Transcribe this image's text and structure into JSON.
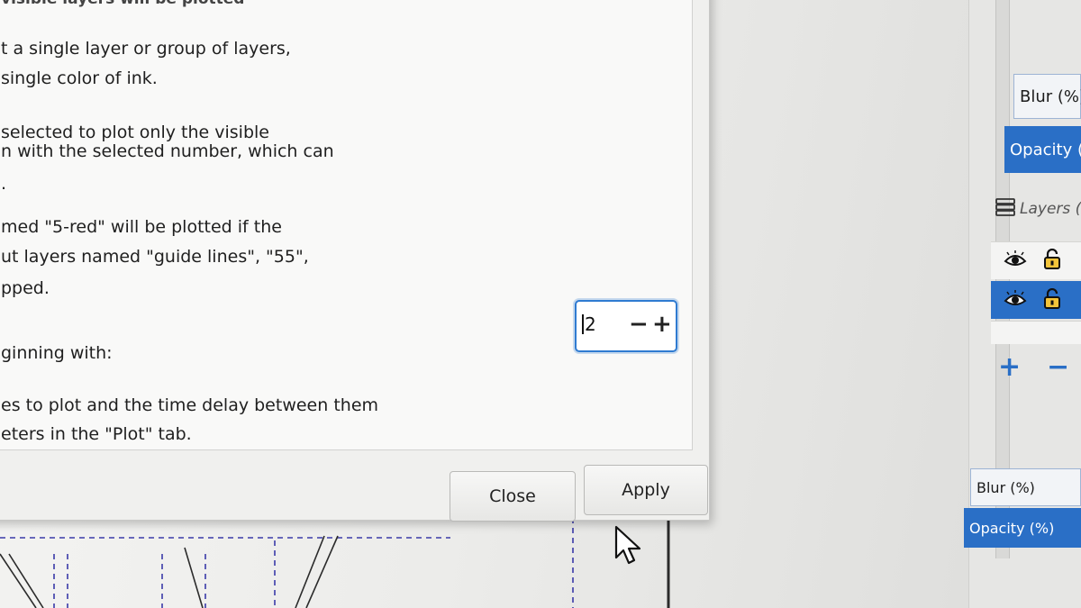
{
  "dialog": {
    "help_text": {
      "line_top": "visible layers will be plotted",
      "line_1": "t a single layer or group of layers,",
      "line_2": "single color of ink.",
      "line_3": "selected to plot only the visible",
      "line_4": "n with the selected number, which can",
      "line_5": ".",
      "line_6": "med \"5-red\" will be plotted if the",
      "line_7": "ut layers named \"guide lines\", \"55\",",
      "line_8": "pped.",
      "line_9": "ginning with:",
      "line_10": "es to plot and the time delay between them",
      "line_11": "eters in the \"Plot\" tab."
    },
    "layer_number": {
      "value": "2",
      "decrement_label": "−",
      "increment_label": "+"
    },
    "buttons": {
      "close_label": "Close",
      "apply_label": "Apply"
    }
  },
  "right_panel": {
    "blur_label_top": "Blur (%)",
    "opacity_label_top": "Opacity (",
    "layers_tab_label": "Layers (S",
    "layer_rows": [
      {
        "visibility_icon": "eye-icon",
        "lock_icon": "lock-open-icon",
        "selected": false
      },
      {
        "visibility_icon": "eye-icon",
        "lock_icon": "lock-open-icon",
        "selected": true
      }
    ],
    "add_layer_label": "+",
    "remove_layer_label": "−",
    "blur_label_bottom": "Blur (%)",
    "opacity_label_bottom": "Opacity (%)"
  },
  "colors": {
    "accent": "#2a6fc6",
    "focus_ring": "#2f7bd1"
  }
}
